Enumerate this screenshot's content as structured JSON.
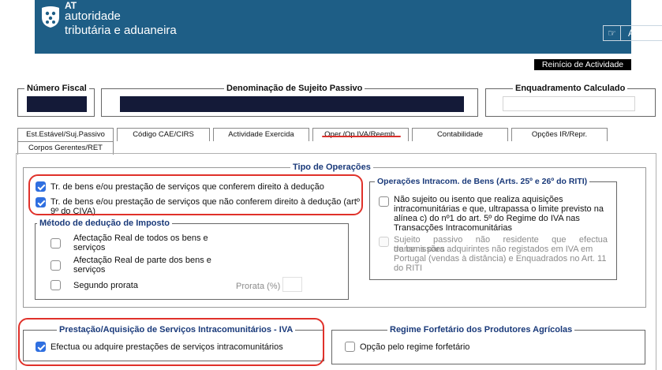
{
  "header": {
    "brand_short": "AT",
    "brand_line1": "autoridade",
    "brand_line2": "tributária e aduaneira",
    "help_label": "Ajuda",
    "restart_label": "Reinício de Actividade"
  },
  "fields": {
    "nif_label": "Número Fiscal",
    "name_label": "Denominação de Sujeito Passivo",
    "framework_label": "Enquadramento Calculado"
  },
  "tabs": [
    {
      "label": "Est.Estável/Suj.Passivo"
    },
    {
      "label": "Código CAE/CIRS"
    },
    {
      "label": "Actividade Exercida"
    },
    {
      "label": "Oper./Op.IVA/Reemb."
    },
    {
      "label": "Contabilidade"
    },
    {
      "label": "Opções IR/Repr."
    },
    {
      "label": "Corpos Gerentes/RET"
    }
  ],
  "active_tab": "Oper./Op.IVA/Reemb.",
  "tipo_operacoes": {
    "legend": "Tipo de Operações",
    "opt1": "Tr. de bens e/ou prestação de serviços que conferem direito à dedução",
    "opt2_line1": "Tr. de bens e/ou prestação de serviços que não conferem direito à dedução (artº",
    "opt2_line2": "9º do CIVA)"
  },
  "metodo": {
    "legend": "Método de dedução de Imposto",
    "opt1_line1": "Afectação Real de todos os bens e",
    "opt1_line2": "serviços",
    "opt2_line1": "Afectação Real de parte dos bens e",
    "opt2_line2": "serviços",
    "opt3": "Segundo prorata",
    "prorata_label": "Prorata (%)"
  },
  "intracom": {
    "legend": "Operações Intracom. de Bens (Arts. 25º e 26º do RITI)",
    "opt1_l1": "Não sujeito ou isento que realiza aquisições",
    "opt1_l2": "intracomunitárias e que, ultrapassa o limite previsto na",
    "opt1_l3": "alínea c) do nº1 do art. 5º do Regime do IVA nas",
    "opt1_l4": "Transacções Intracomunitárias",
    "opt2_l1": "Sujeito passivo não residente que efectua transmissões",
    "opt2_l2": "de bens para adquirintes não registados em IVA em",
    "opt2_l3": "Portugal (vendas à distância) e Enquadrados no Art. 11",
    "opt2_l4": "do RITI"
  },
  "servicos": {
    "legend": "Prestação/Aquisição de Serviços Intracomunitários - IVA",
    "opt1": "Efectua ou adquire prestações de serviços intracomunitários"
  },
  "forfetario": {
    "legend": "Regime Forfetário dos Produtores Agrícolas",
    "opt1": "Opção pelo regime forfetário"
  },
  "colors": {
    "banner": "#1e5e86",
    "highlight": "#e0312a",
    "checkbox_checked": "#2f6fe0",
    "redacted_field": "#141a38"
  }
}
